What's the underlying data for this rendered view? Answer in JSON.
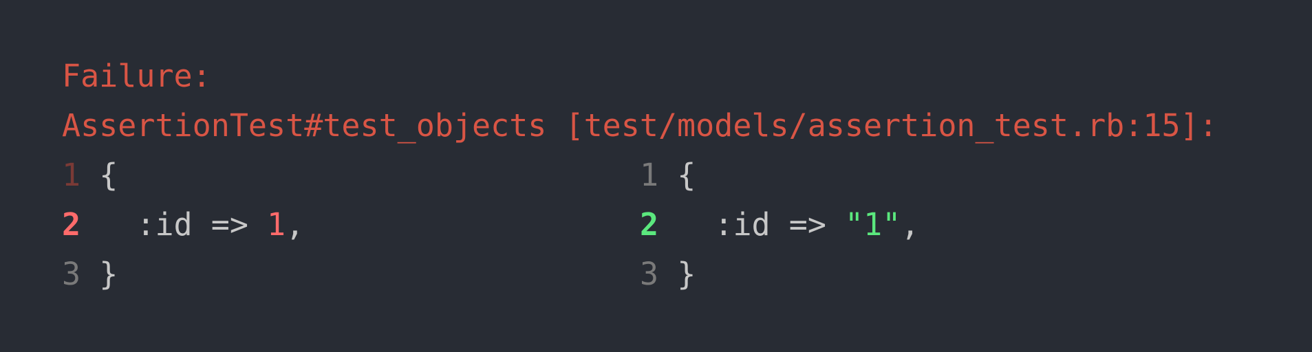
{
  "header": {
    "failure_label": "Failure:",
    "test_location": "AssertionTest#test_objects [test/models/assertion_test.rb:15]:"
  },
  "diff": {
    "left": {
      "lines": [
        {
          "num": "1",
          "code": "{"
        },
        {
          "num": "2",
          "code_prefix": "  :id => ",
          "value": "1",
          "code_suffix": ","
        },
        {
          "num": "3",
          "code": "}"
        }
      ]
    },
    "right": {
      "lines": [
        {
          "num": "1",
          "code": "{"
        },
        {
          "num": "2",
          "code_prefix": "  :id => ",
          "value": "\"1\"",
          "code_suffix": ","
        },
        {
          "num": "3",
          "code": "}"
        }
      ]
    }
  },
  "colors": {
    "background": "#282c34",
    "failure": "#d95545",
    "removed": "#ff6b6b",
    "added": "#5be87e"
  }
}
